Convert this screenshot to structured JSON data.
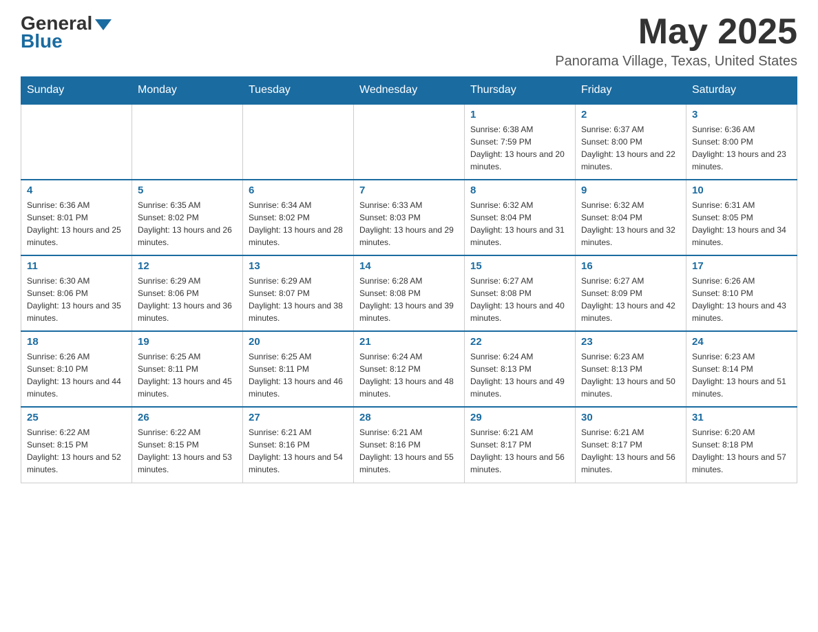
{
  "logo": {
    "general": "General",
    "arrow": "▼",
    "blue": "Blue"
  },
  "title": "May 2025",
  "location": "Panorama Village, Texas, United States",
  "days_of_week": [
    "Sunday",
    "Monday",
    "Tuesday",
    "Wednesday",
    "Thursday",
    "Friday",
    "Saturday"
  ],
  "weeks": [
    [
      {
        "day": "",
        "info": ""
      },
      {
        "day": "",
        "info": ""
      },
      {
        "day": "",
        "info": ""
      },
      {
        "day": "",
        "info": ""
      },
      {
        "day": "1",
        "info": "Sunrise: 6:38 AM\nSunset: 7:59 PM\nDaylight: 13 hours and 20 minutes."
      },
      {
        "day": "2",
        "info": "Sunrise: 6:37 AM\nSunset: 8:00 PM\nDaylight: 13 hours and 22 minutes."
      },
      {
        "day": "3",
        "info": "Sunrise: 6:36 AM\nSunset: 8:00 PM\nDaylight: 13 hours and 23 minutes."
      }
    ],
    [
      {
        "day": "4",
        "info": "Sunrise: 6:36 AM\nSunset: 8:01 PM\nDaylight: 13 hours and 25 minutes."
      },
      {
        "day": "5",
        "info": "Sunrise: 6:35 AM\nSunset: 8:02 PM\nDaylight: 13 hours and 26 minutes."
      },
      {
        "day": "6",
        "info": "Sunrise: 6:34 AM\nSunset: 8:02 PM\nDaylight: 13 hours and 28 minutes."
      },
      {
        "day": "7",
        "info": "Sunrise: 6:33 AM\nSunset: 8:03 PM\nDaylight: 13 hours and 29 minutes."
      },
      {
        "day": "8",
        "info": "Sunrise: 6:32 AM\nSunset: 8:04 PM\nDaylight: 13 hours and 31 minutes."
      },
      {
        "day": "9",
        "info": "Sunrise: 6:32 AM\nSunset: 8:04 PM\nDaylight: 13 hours and 32 minutes."
      },
      {
        "day": "10",
        "info": "Sunrise: 6:31 AM\nSunset: 8:05 PM\nDaylight: 13 hours and 34 minutes."
      }
    ],
    [
      {
        "day": "11",
        "info": "Sunrise: 6:30 AM\nSunset: 8:06 PM\nDaylight: 13 hours and 35 minutes."
      },
      {
        "day": "12",
        "info": "Sunrise: 6:29 AM\nSunset: 8:06 PM\nDaylight: 13 hours and 36 minutes."
      },
      {
        "day": "13",
        "info": "Sunrise: 6:29 AM\nSunset: 8:07 PM\nDaylight: 13 hours and 38 minutes."
      },
      {
        "day": "14",
        "info": "Sunrise: 6:28 AM\nSunset: 8:08 PM\nDaylight: 13 hours and 39 minutes."
      },
      {
        "day": "15",
        "info": "Sunrise: 6:27 AM\nSunset: 8:08 PM\nDaylight: 13 hours and 40 minutes."
      },
      {
        "day": "16",
        "info": "Sunrise: 6:27 AM\nSunset: 8:09 PM\nDaylight: 13 hours and 42 minutes."
      },
      {
        "day": "17",
        "info": "Sunrise: 6:26 AM\nSunset: 8:10 PM\nDaylight: 13 hours and 43 minutes."
      }
    ],
    [
      {
        "day": "18",
        "info": "Sunrise: 6:26 AM\nSunset: 8:10 PM\nDaylight: 13 hours and 44 minutes."
      },
      {
        "day": "19",
        "info": "Sunrise: 6:25 AM\nSunset: 8:11 PM\nDaylight: 13 hours and 45 minutes."
      },
      {
        "day": "20",
        "info": "Sunrise: 6:25 AM\nSunset: 8:11 PM\nDaylight: 13 hours and 46 minutes."
      },
      {
        "day": "21",
        "info": "Sunrise: 6:24 AM\nSunset: 8:12 PM\nDaylight: 13 hours and 48 minutes."
      },
      {
        "day": "22",
        "info": "Sunrise: 6:24 AM\nSunset: 8:13 PM\nDaylight: 13 hours and 49 minutes."
      },
      {
        "day": "23",
        "info": "Sunrise: 6:23 AM\nSunset: 8:13 PM\nDaylight: 13 hours and 50 minutes."
      },
      {
        "day": "24",
        "info": "Sunrise: 6:23 AM\nSunset: 8:14 PM\nDaylight: 13 hours and 51 minutes."
      }
    ],
    [
      {
        "day": "25",
        "info": "Sunrise: 6:22 AM\nSunset: 8:15 PM\nDaylight: 13 hours and 52 minutes."
      },
      {
        "day": "26",
        "info": "Sunrise: 6:22 AM\nSunset: 8:15 PM\nDaylight: 13 hours and 53 minutes."
      },
      {
        "day": "27",
        "info": "Sunrise: 6:21 AM\nSunset: 8:16 PM\nDaylight: 13 hours and 54 minutes."
      },
      {
        "day": "28",
        "info": "Sunrise: 6:21 AM\nSunset: 8:16 PM\nDaylight: 13 hours and 55 minutes."
      },
      {
        "day": "29",
        "info": "Sunrise: 6:21 AM\nSunset: 8:17 PM\nDaylight: 13 hours and 56 minutes."
      },
      {
        "day": "30",
        "info": "Sunrise: 6:21 AM\nSunset: 8:17 PM\nDaylight: 13 hours and 56 minutes."
      },
      {
        "day": "31",
        "info": "Sunrise: 6:20 AM\nSunset: 8:18 PM\nDaylight: 13 hours and 57 minutes."
      }
    ]
  ]
}
